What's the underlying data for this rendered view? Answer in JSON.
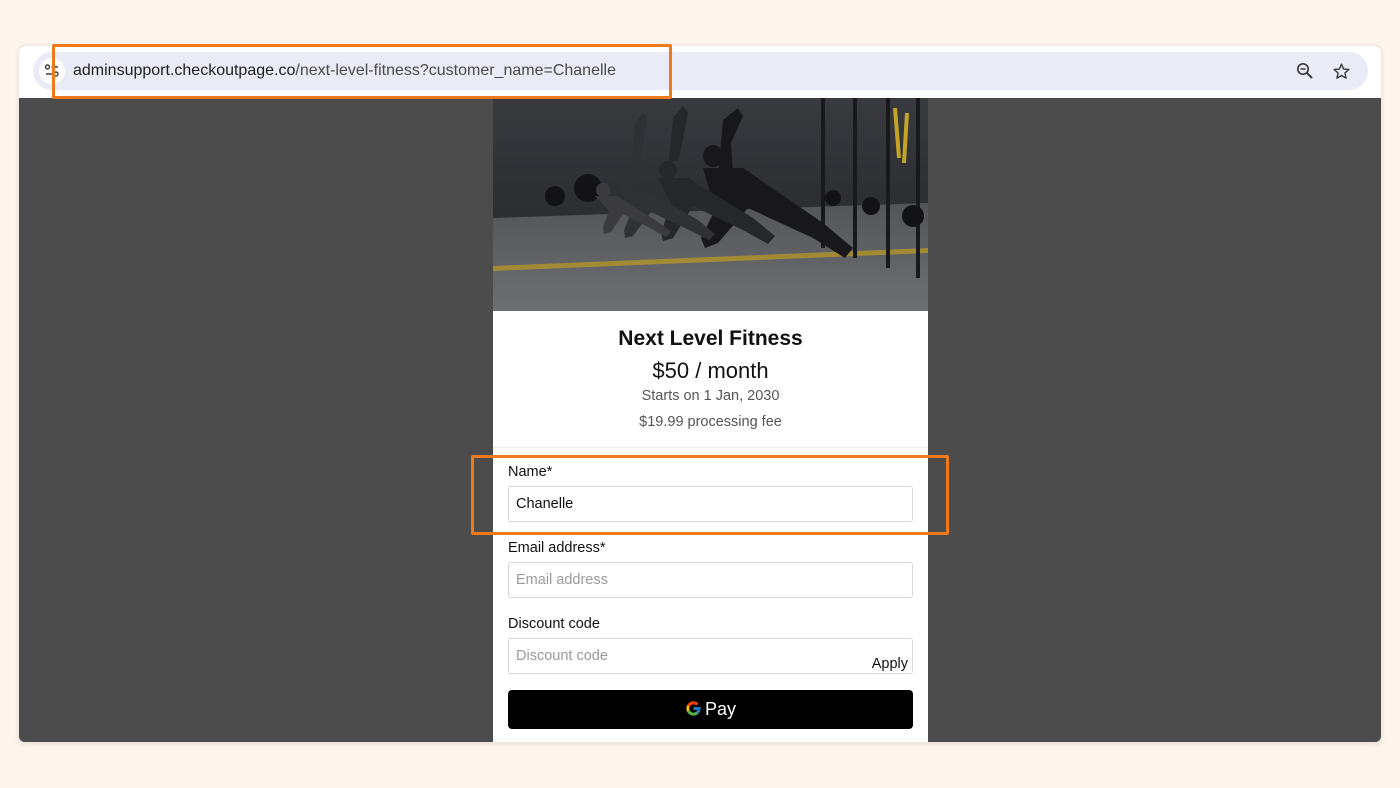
{
  "browser": {
    "url_host": "adminsupport.checkoutpage.co",
    "url_path": "/next-level-fitness?customer_name=Chanelle"
  },
  "product": {
    "title": "Next Level Fitness",
    "price": "$50 / month",
    "starts": "Starts on 1 Jan, 2030",
    "fee": "$19.99 processing fee"
  },
  "form": {
    "name_label": "Name",
    "name_value": "Chanelle",
    "email_label": "Email address",
    "email_placeholder": "Email address",
    "discount_label": "Discount code",
    "discount_placeholder": "Discount code",
    "apply_label": "Apply",
    "required_mark": "*"
  },
  "pay_button": {
    "label": "Pay"
  },
  "colors": {
    "highlight": "#f07a1a",
    "page_background": "#fdf5ec",
    "viewport_background": "#4c4c4c",
    "pay_button": "#000000"
  }
}
